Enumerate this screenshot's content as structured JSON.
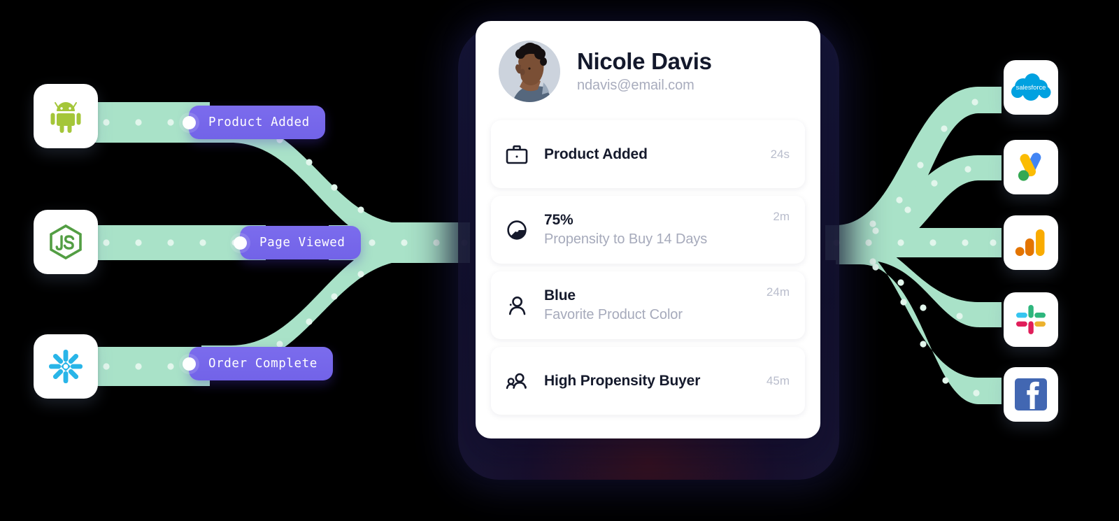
{
  "theme": {
    "background": "#000000",
    "ribbon_color": "#a9e2c8",
    "ribbon_dot_color": "#d9f2e6",
    "pill_color": "#7263e8",
    "card_background": "#ffffff",
    "title_color": "#13182b",
    "muted_color": "#a8acbd"
  },
  "profile": {
    "name": "Nicole Davis",
    "email": "ndavis@email.com",
    "avatar_name": "avatar-illustration",
    "attributes": [
      {
        "icon": "briefcase-icon",
        "title": "Product Added",
        "subtitle": "",
        "time": "24s"
      },
      {
        "icon": "pie-chart-icon",
        "title": "75%",
        "subtitle": "Propensity to Buy 14 Days",
        "time": "2m"
      },
      {
        "icon": "user-icon",
        "title": "Blue",
        "subtitle": "Favorite Product Color",
        "time": "24m"
      },
      {
        "icon": "users-icon",
        "title": "High Propensity Buyer",
        "subtitle": "",
        "time": "45m"
      }
    ]
  },
  "events": [
    {
      "label": "Product Added",
      "icon": "event-dot"
    },
    {
      "label": "Page Viewed",
      "icon": "event-dot"
    },
    {
      "label": "Order Complete",
      "icon": "event-dot"
    }
  ],
  "sources": [
    {
      "name": "android-icon",
      "label": "Android"
    },
    {
      "name": "nodejs-icon",
      "label": "Node.js"
    },
    {
      "name": "snowflake-icon",
      "label": "Snowflake"
    }
  ],
  "destinations": [
    {
      "name": "salesforce-icon",
      "label": "Salesforce"
    },
    {
      "name": "google-ads-icon",
      "label": "Google Ads"
    },
    {
      "name": "google-analytics-icon",
      "label": "Google Analytics"
    },
    {
      "name": "slack-icon",
      "label": "Slack"
    },
    {
      "name": "facebook-icon",
      "label": "Facebook"
    }
  ]
}
